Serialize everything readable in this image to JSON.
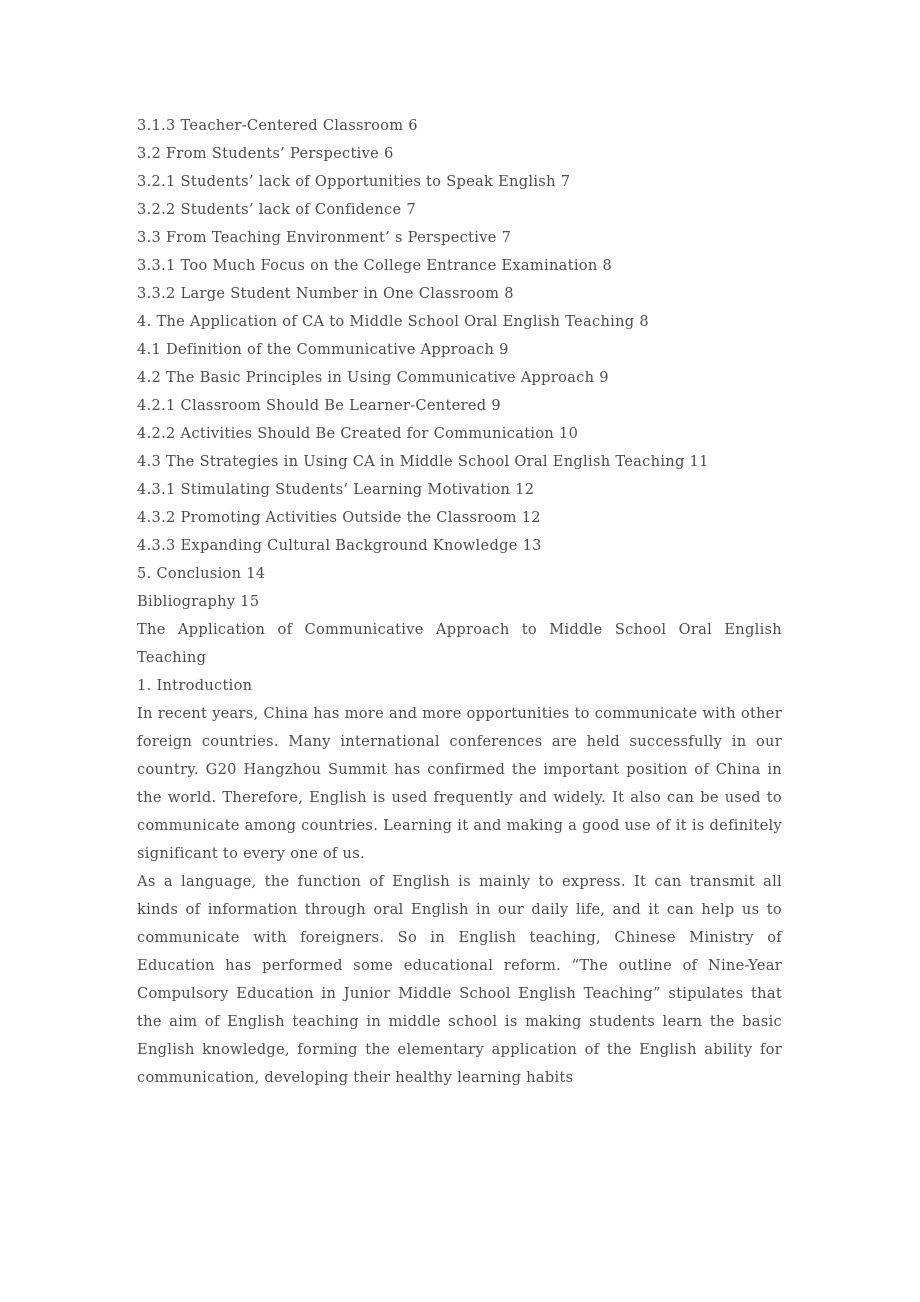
{
  "document": {
    "page_background": "#ffffff",
    "text_color": "#4c4c4c",
    "toc_entries": [
      {
        "text": "3.1.3 Teacher-Centered Classroom 6"
      },
      {
        "text": "3.2 From Students’ Perspective 6"
      },
      {
        "text": "3.2.1 Students’ lack of Opportunities to Speak English 7"
      },
      {
        "text": "3.2.2 Students’ lack of Confidence 7"
      },
      {
        "text": "3.3 From Teaching Environment’ s Perspective 7"
      },
      {
        "text": "3.3.1 Too Much Focus on the College Entrance Examination 8"
      },
      {
        "text": "3.3.2 Large Student Number in One Classroom 8"
      },
      {
        "text": "4. The Application of CA to Middle School Oral English Teaching 8"
      },
      {
        "text": "4.1 Definition of the Communicative Approach 9"
      },
      {
        "text": "4.2 The Basic Principles in Using Communicative Approach 9"
      },
      {
        "text": "4.2.1 Classroom Should Be Learner-Centered 9"
      },
      {
        "text": "4.2.2 Activities Should Be Created for Communication 10"
      },
      {
        "text": "4.3 The Strategies in Using CA in Middle School Oral English Teaching 11"
      },
      {
        "text": "4.3.1 Stimulating Students’ Learning Motivation 12"
      },
      {
        "text": "4.3.2 Promoting Activities Outside the Classroom 12"
      },
      {
        "text": "4.3.3 Expanding Cultural Background Knowledge 13"
      },
      {
        "text": "5. Conclusion 14"
      },
      {
        "text": "Bibliography 15"
      }
    ],
    "paper_title": "The Application of Communicative Approach to Middle School Oral English Teaching",
    "section_heading": "1. Introduction",
    "paragraphs": [
      {
        "text": "In recent years, China has more and more opportunities to communicate with other foreign countries. Many international conferences are held successfully in our country. G20 Hangzhou Summit has confirmed the important position of China in the world. Therefore, English is used frequently and widely. It also can be used to communicate among countries. Learning it and making a good use of it is definitely significant to every one of us."
      },
      {
        "text": "As a language, the function of English is mainly to express. It can transmit all kinds of information through oral English in our daily life, and it can help us to communicate with foreigners. So in English teaching, Chinese Ministry of Education has performed some educational reform. “The outline of Nine-Year Compulsory Education in Junior Middle School English Teaching” stipulates that the aim of English teaching in middle school is making students learn the basic English knowledge, forming the elementary application of the English ability for communication, developing their healthy learning habits"
      }
    ]
  }
}
